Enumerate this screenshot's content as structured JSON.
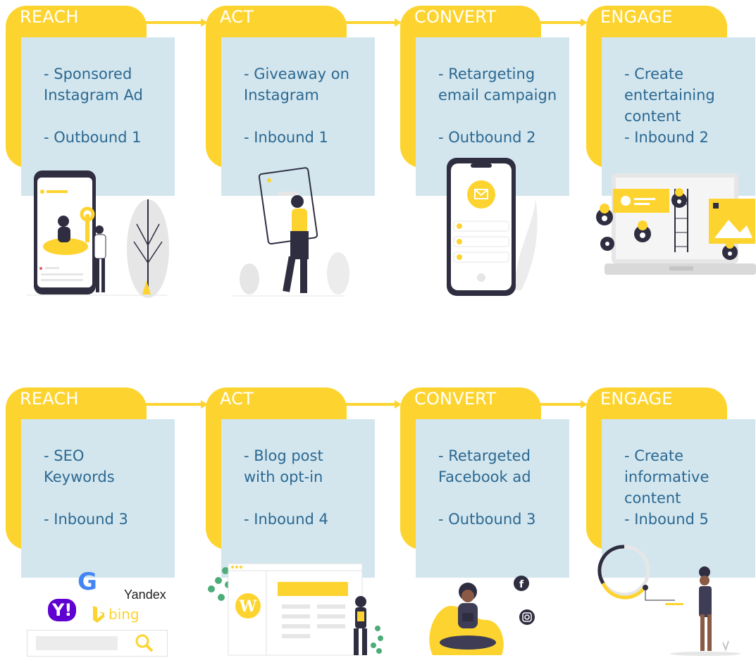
{
  "rows": [
    {
      "cards": [
        {
          "stage": "REACH",
          "lines": [
            "- Sponsored",
            "Instagram Ad",
            "",
            "- Outbound 1"
          ]
        },
        {
          "stage": "ACT",
          "lines": [
            "- Giveaway on",
            "Instagram",
            "",
            "- Inbound 1"
          ]
        },
        {
          "stage": "CONVERT",
          "lines": [
            "- Retargeting",
            "email campaign",
            "",
            "- Outbound 2"
          ]
        },
        {
          "stage": "ENGAGE",
          "lines": [
            "- Create",
            "entertaining",
            "content",
            "- Inbound 2"
          ]
        }
      ]
    },
    {
      "cards": [
        {
          "stage": "REACH",
          "lines": [
            "- SEO",
            "Keywords",
            "",
            "- Inbound 3"
          ]
        },
        {
          "stage": "ACT",
          "lines": [
            "- Blog post",
            "with opt-in",
            "",
            "- Inbound 4"
          ]
        },
        {
          "stage": "CONVERT",
          "lines": [
            "- Retargeted",
            "Facebook ad",
            "",
            "- Outbound 3"
          ]
        },
        {
          "stage": "ENGAGE",
          "lines": [
            "- Create",
            "informative",
            "content",
            "- Inbound 5"
          ]
        }
      ]
    }
  ],
  "logos": {
    "google": "G",
    "yahoo": "Y!",
    "bing": "bing",
    "yandex": "Yandex"
  },
  "colors": {
    "yellow": "#fdd42f",
    "blue_blob": "#d3e6ee",
    "text": "#2b6891",
    "dark": "#2f2e41"
  }
}
